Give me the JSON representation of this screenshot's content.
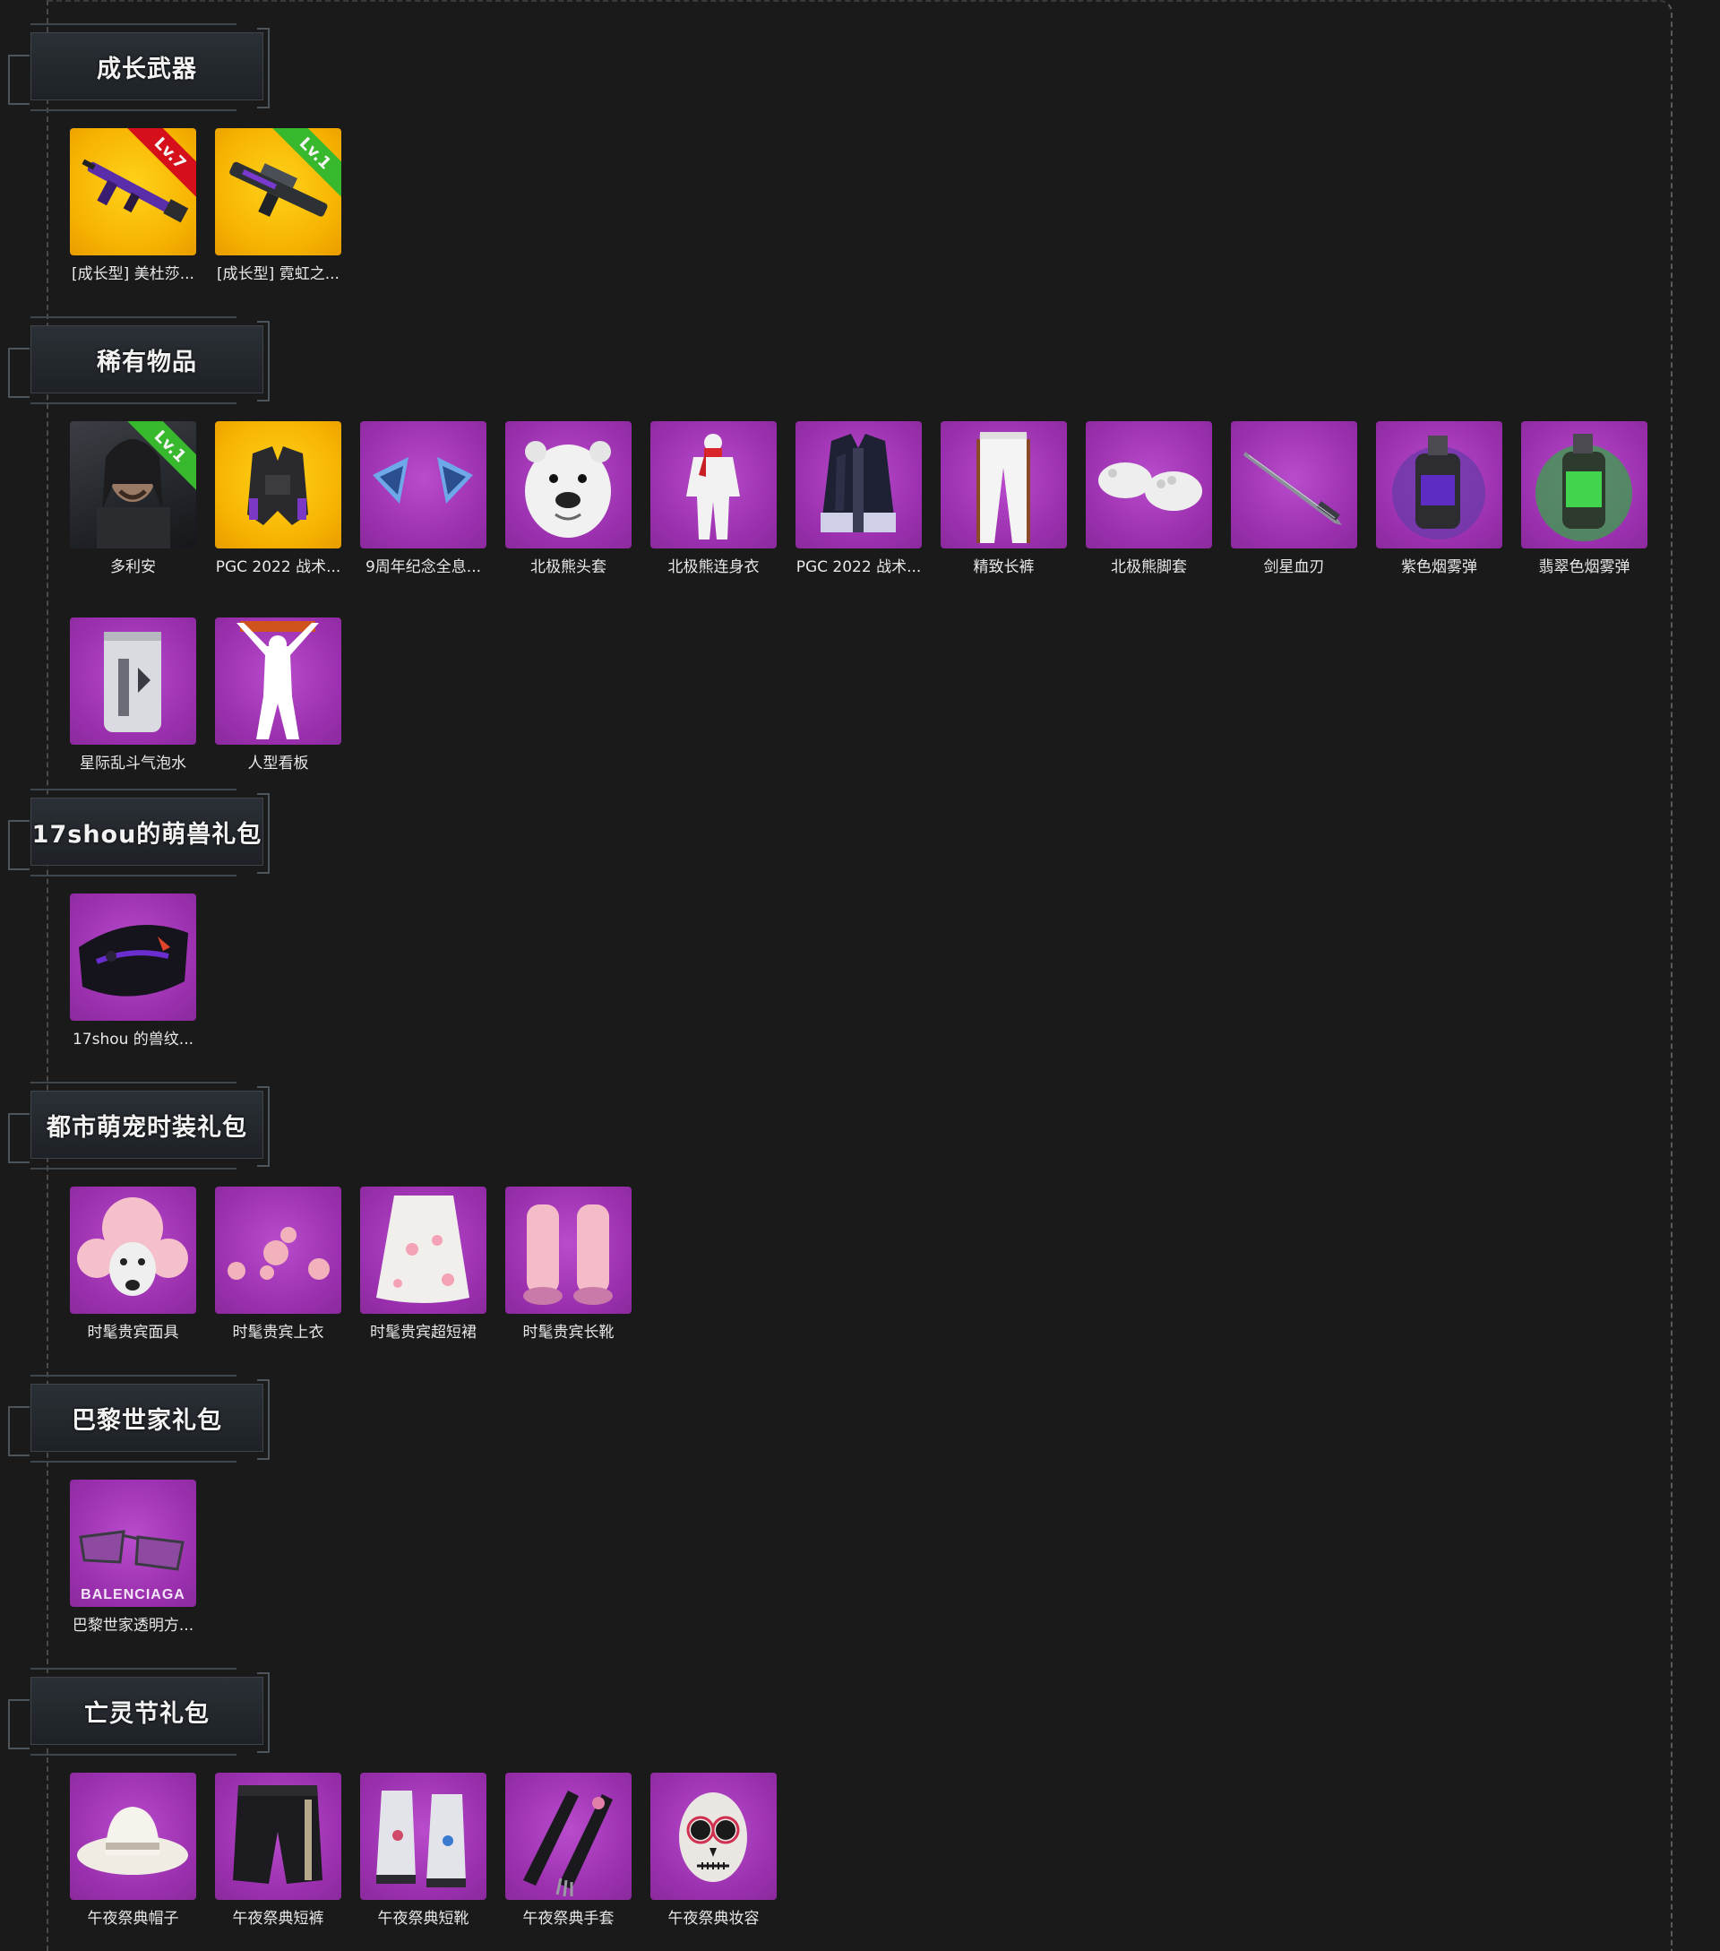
{
  "sections": [
    {
      "title": "成长武器",
      "items": [
        {
          "label": "[成长型] 美杜莎...",
          "bg": "gold",
          "icon": "rifle-icon",
          "badge": "Lv.7",
          "badge_color": "red"
        },
        {
          "label": "[成长型] 霓虹之...",
          "bg": "gold",
          "icon": "assault-rifle-icon",
          "badge": "Lv.1",
          "badge_color": "green"
        }
      ]
    },
    {
      "title": "稀有物品",
      "items": [
        {
          "label": "多利安",
          "bg": "dark",
          "icon": "character-portrait-icon",
          "badge": "Lv.1",
          "badge_color": "green"
        },
        {
          "label": "PGC 2022 战术...",
          "bg": "gold",
          "icon": "tactical-vest-icon"
        },
        {
          "label": "9周年纪念全息...",
          "bg": "purple",
          "icon": "cat-ears-icon"
        },
        {
          "label": "北极熊头套",
          "bg": "purple",
          "icon": "polar-bear-head-icon"
        },
        {
          "label": "北极熊连身衣",
          "bg": "purple",
          "icon": "bodysuit-icon"
        },
        {
          "label": "PGC 2022 战术...",
          "bg": "purple",
          "icon": "coat-icon"
        },
        {
          "label": "精致长裤",
          "bg": "purple",
          "icon": "pants-icon"
        },
        {
          "label": "北极熊脚套",
          "bg": "purple",
          "icon": "paw-shoes-icon"
        },
        {
          "label": "剑星血刃",
          "bg": "purple",
          "icon": "sword-icon"
        },
        {
          "label": "紫色烟雾弹",
          "bg": "purple",
          "icon": "purple-smoke-grenade-icon"
        },
        {
          "label": "翡翠色烟雾弹",
          "bg": "purple",
          "icon": "green-smoke-grenade-icon"
        },
        {
          "label": "星际乱斗气泡水",
          "bg": "purple",
          "icon": "soda-can-icon"
        },
        {
          "label": "人型看板",
          "bg": "purple",
          "icon": "human-sign-icon"
        }
      ]
    },
    {
      "title": "17shou的萌兽礼包",
      "items": [
        {
          "label": "17shou 的兽纹...",
          "bg": "purple",
          "icon": "beast-mask-icon"
        }
      ]
    },
    {
      "title": "都市萌宠时装礼包",
      "items": [
        {
          "label": "时髦贵宾面具",
          "bg": "purple",
          "icon": "poodle-mask-icon"
        },
        {
          "label": "时髦贵宾上衣",
          "bg": "purple",
          "icon": "fluffy-top-icon"
        },
        {
          "label": "时髦贵宾超短裙",
          "bg": "purple",
          "icon": "skirt-icon"
        },
        {
          "label": "时髦贵宾长靴",
          "bg": "purple",
          "icon": "fluffy-boots-icon"
        }
      ]
    },
    {
      "title": "巴黎世家礼包",
      "items": [
        {
          "label": "巴黎世家透明方...",
          "bg": "purple",
          "icon": "sunglasses-icon",
          "brand": "BALENCIAGA"
        }
      ]
    },
    {
      "title": "亡灵节礼包",
      "items": [
        {
          "label": "午夜祭典帽子",
          "bg": "purple",
          "icon": "cowboy-hat-icon"
        },
        {
          "label": "午夜祭典短裤",
          "bg": "purple",
          "icon": "shorts-icon"
        },
        {
          "label": "午夜祭典短靴",
          "bg": "purple",
          "icon": "boots-icon"
        },
        {
          "label": "午夜祭典手套",
          "bg": "purple",
          "icon": "gloves-icon"
        },
        {
          "label": "午夜祭典妆容",
          "bg": "purple",
          "icon": "skull-makeup-icon"
        }
      ]
    }
  ]
}
